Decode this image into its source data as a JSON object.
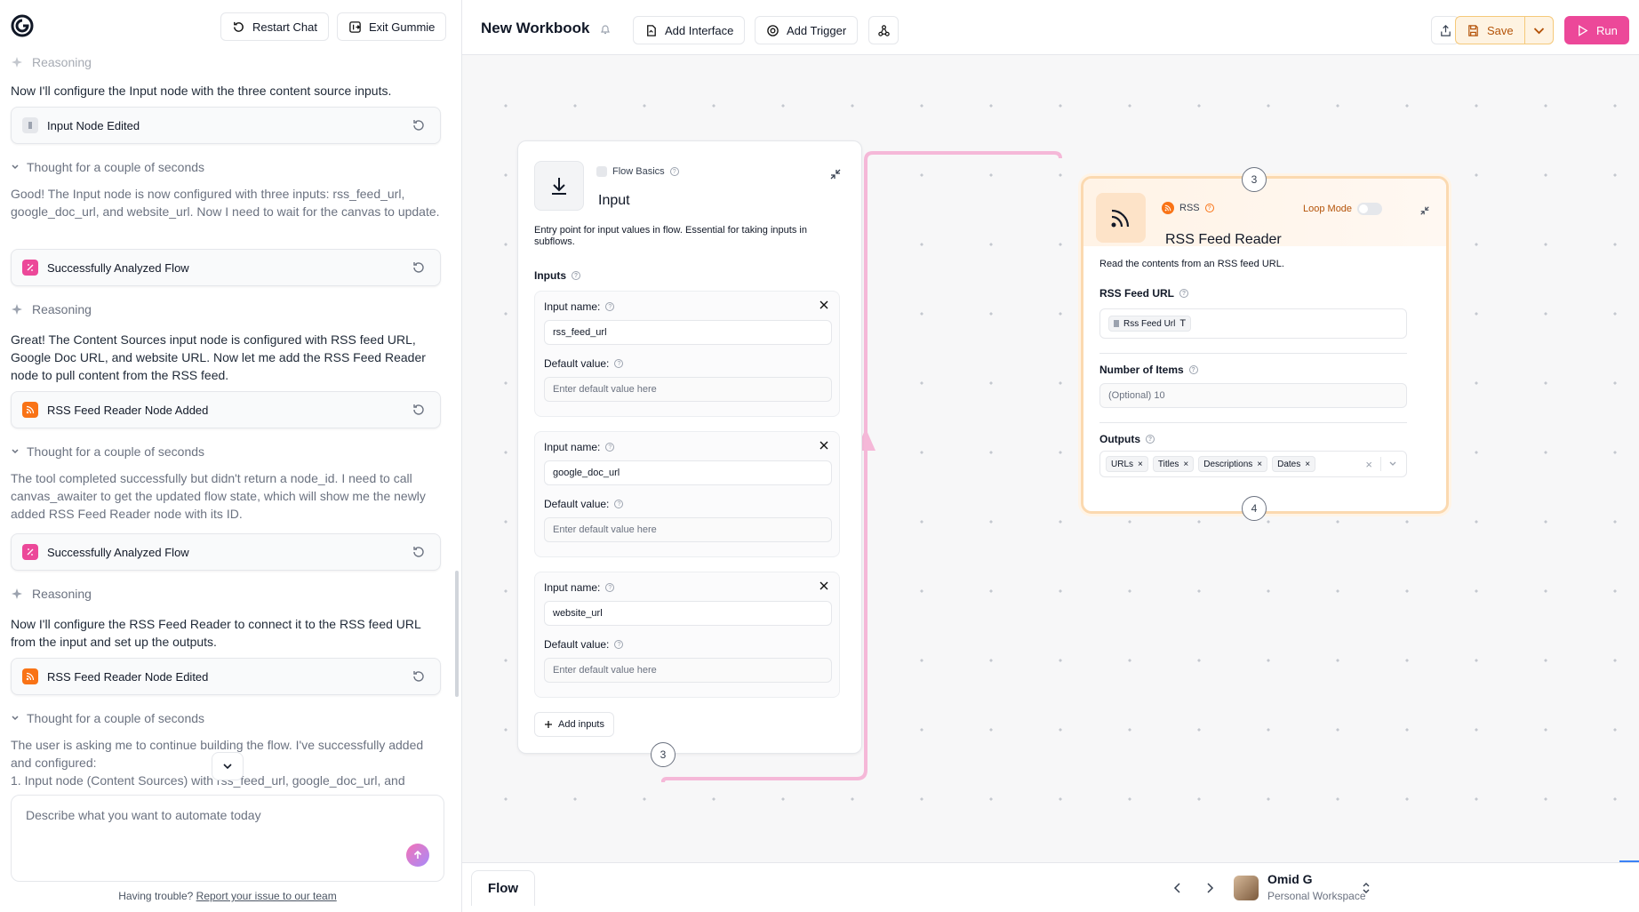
{
  "chat": {
    "restart_label": "Restart Chat",
    "exit_label": "Exit Gummie",
    "top_reasoning": "Reasoning",
    "msg1": "Now I'll configure the Input node with the three content source inputs.",
    "ev1": "Input Node Edited",
    "thought1": "Thought for a couple of seconds",
    "thought1_text": "Good! The Input node is now configured with three inputs: rss_feed_url, google_doc_url, and website_url. Now I need to wait for the canvas to update.",
    "ev2": "Successfully Analyzed Flow",
    "reasoning2": "Reasoning",
    "msg2": "Great! The Content Sources input node is configured with RSS feed URL, Google Doc URL, and website URL. Now let me add the RSS Feed Reader node to pull content from the RSS feed.",
    "ev3": "RSS Feed Reader Node Added",
    "thought2": "Thought for a couple of seconds",
    "thought2_text": "The tool completed successfully but didn't return a node_id. I need to call canvas_awaiter to get the updated flow state, which will show me the newly added RSS Feed Reader node with its ID.",
    "ev4": "Successfully Analyzed Flow",
    "reasoning3": "Reasoning",
    "msg3": "Now I'll configure the RSS Feed Reader to connect it to the RSS feed URL from the input and set up the outputs.",
    "ev5": "RSS Feed Reader Node Edited",
    "thought3": "Thought for a couple of seconds",
    "thought3_text": "The user is asking me to continue building the flow. I've successfully added and configured:",
    "thought3_item": "1. Input node (Content Sources) with rss_feed_url, google_doc_url, and",
    "composer_placeholder": "Describe what you want to automate today",
    "help_text": "Having trouble?",
    "help_link": "Report your issue to our team"
  },
  "workbook": {
    "title": "New Workbook",
    "add_interface": "Add Interface",
    "add_trigger": "Add Trigger",
    "save": "Save",
    "run": "Run"
  },
  "input_node": {
    "category": "Flow Basics",
    "title": "Input",
    "description": "Entry point for input values in flow. Essential for taking inputs in subflows.",
    "section": "Inputs",
    "input_name_label": "Input name:",
    "default_value_label": "Default value:",
    "default_placeholder": "Enter default value here",
    "inputs": [
      {
        "name": "rss_feed_url"
      },
      {
        "name": "google_doc_url"
      },
      {
        "name": "website_url"
      }
    ],
    "add_inputs": "Add inputs",
    "handle_count": "3"
  },
  "rss_node": {
    "category": "RSS",
    "title": "RSS Feed Reader",
    "loop_mode": "Loop Mode",
    "description": "Read the contents from an RSS feed URL.",
    "url_label": "RSS Feed URL",
    "url_chip": "Rss Feed Url",
    "items_label": "Number of Items",
    "items_placeholder": "(Optional) 10",
    "outputs_label": "Outputs",
    "outputs": [
      "URLs",
      "Titles",
      "Descriptions",
      "Dates"
    ],
    "top_handle": "3",
    "bottom_handle": "4"
  },
  "footer": {
    "tab": "Flow",
    "user_name": "Omid G",
    "workspace": "Personal Workspace"
  },
  "colors": {
    "accent_pink": "#ec4899",
    "save_orange": "#f59e0b",
    "edge_pink": "#f5b8d8",
    "rss_orange": "#f97316"
  }
}
